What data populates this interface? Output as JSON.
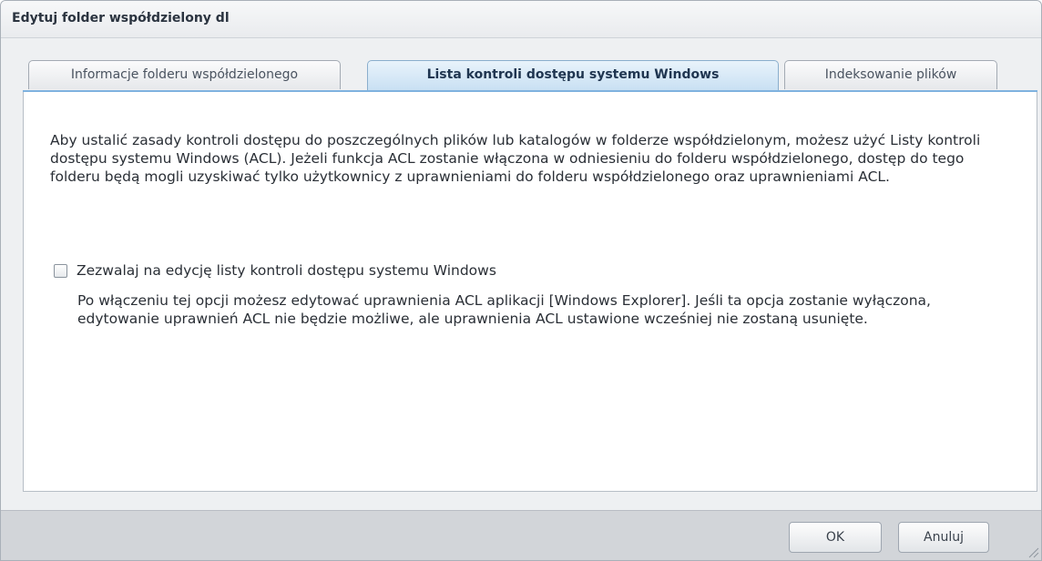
{
  "dialog": {
    "title": "Edytuj folder współdzielony dl"
  },
  "tabs": [
    {
      "label": "Informacje folderu współdzielonego",
      "active": false
    },
    {
      "label": "Lista kontroli dostępu systemu Windows",
      "active": true
    },
    {
      "label": "Indeksowanie plików",
      "active": false
    }
  ],
  "content": {
    "description": "Aby ustalić zasady kontroli dostępu do poszczególnych plików lub katalogów w folderze współdzielonym, możesz użyć Listy kontroli dostępu systemu Windows (ACL). Jeżeli funkcja ACL zostanie włączona w odniesieniu do folderu współdzielonego, dostęp do tego folderu będą mogli uzyskiwać tylko użytkownicy z uprawnieniami do folderu współdzielonego oraz uprawnieniami ACL.",
    "checkbox": {
      "label": "Zezwalaj na edycję listy kontroli dostępu systemu Windows",
      "checked": false
    },
    "hint": "Po włączeniu tej opcji możesz edytować uprawnienia ACL aplikacji [Windows Explorer]. Jeśli ta opcja zostanie wyłączona, edytowanie uprawnień ACL nie będzie możliwe, ale uprawnienia ACL ustawione wcześniej nie zostaną usunięte."
  },
  "footer": {
    "ok_label": "OK",
    "cancel_label": "Anuluj"
  },
  "colors": {
    "active_tab_accent": "#7fb2df",
    "title_text": "#2b3440"
  },
  "icons": {
    "resize_handle": "resize-grip-icon"
  }
}
